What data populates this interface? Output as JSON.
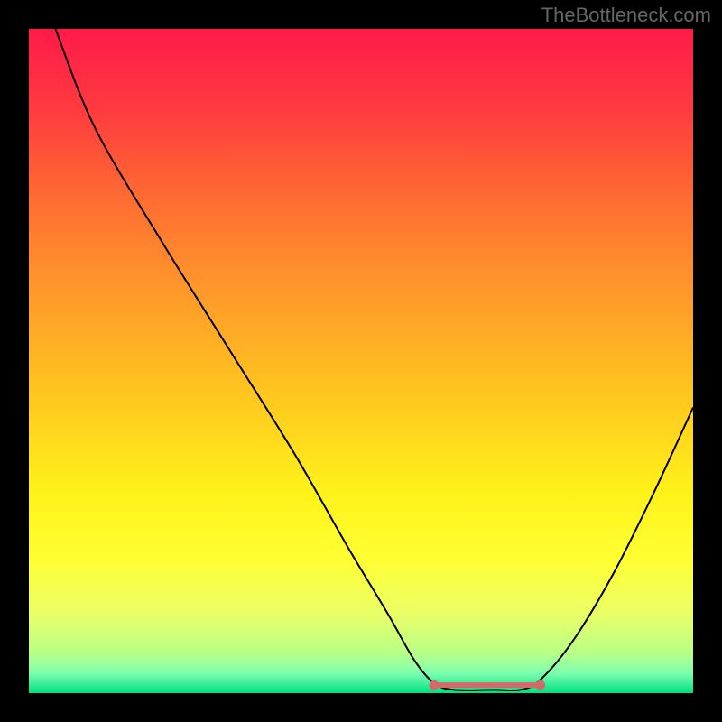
{
  "attribution": "TheBottleneck.com",
  "chart_data": {
    "type": "line",
    "title": "",
    "xlabel": "",
    "ylabel": "",
    "xlim": [
      0,
      100
    ],
    "ylim": [
      0,
      100
    ],
    "background_gradient": {
      "stops": [
        {
          "offset": 0.0,
          "color": "#ff1a4a"
        },
        {
          "offset": 0.12,
          "color": "#ff3a3f"
        },
        {
          "offset": 0.25,
          "color": "#ff6a33"
        },
        {
          "offset": 0.4,
          "color": "#ff9a2a"
        },
        {
          "offset": 0.55,
          "color": "#ffc61f"
        },
        {
          "offset": 0.7,
          "color": "#fff21a"
        },
        {
          "offset": 0.8,
          "color": "#ffff33"
        },
        {
          "offset": 0.88,
          "color": "#eaff66"
        },
        {
          "offset": 0.94,
          "color": "#b8ff88"
        },
        {
          "offset": 0.97,
          "color": "#7dffb0"
        },
        {
          "offset": 1.0,
          "color": "#00e080"
        }
      ]
    },
    "series": [
      {
        "name": "bottleneck-curve",
        "color": "#000000",
        "width": 2,
        "points": [
          {
            "x": 4.0,
            "y": 100.0
          },
          {
            "x": 10.0,
            "y": 85.0
          },
          {
            "x": 20.0,
            "y": 68.0
          },
          {
            "x": 30.0,
            "y": 52.0
          },
          {
            "x": 40.0,
            "y": 36.0
          },
          {
            "x": 48.0,
            "y": 22.0
          },
          {
            "x": 54.0,
            "y": 12.0
          },
          {
            "x": 58.0,
            "y": 5.0
          },
          {
            "x": 61.0,
            "y": 1.5
          },
          {
            "x": 64.0,
            "y": 0.5
          },
          {
            "x": 70.0,
            "y": 0.5
          },
          {
            "x": 74.0,
            "y": 0.5
          },
          {
            "x": 77.0,
            "y": 2.0
          },
          {
            "x": 82.0,
            "y": 8.0
          },
          {
            "x": 88.0,
            "y": 18.0
          },
          {
            "x": 94.0,
            "y": 30.0
          },
          {
            "x": 100.0,
            "y": 43.0
          }
        ]
      }
    ],
    "optimal_band": {
      "color": "#d26a6a",
      "x_start": 61.0,
      "x_end": 77.0,
      "y": 1.2,
      "thickness": 6,
      "end_markers": true
    }
  }
}
